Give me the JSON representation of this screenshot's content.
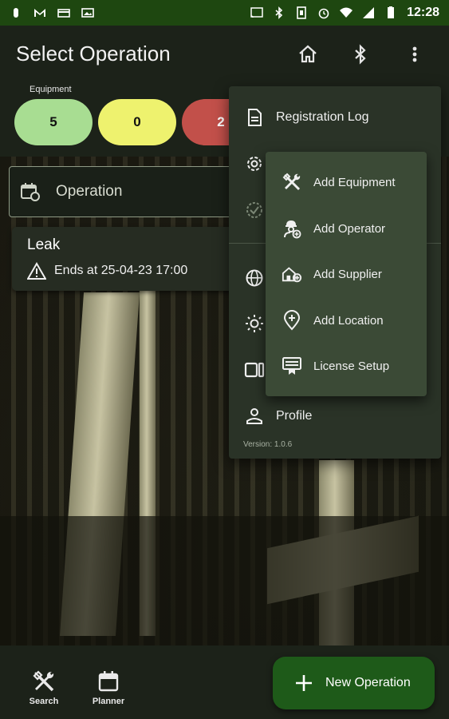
{
  "status_bar": {
    "time": "12:28"
  },
  "app_bar": {
    "title": "Select Operation"
  },
  "counters": {
    "label": "Equipment",
    "green": "5",
    "yellow": "0",
    "red": "2"
  },
  "operation_field": {
    "label": "Operation"
  },
  "leak_card": {
    "title": "Leak",
    "subtitle": "Ends at 25-04-23 17:00"
  },
  "menu": {
    "items": [
      {
        "label": "Registration Log",
        "icon": "document-icon"
      },
      {
        "label": "",
        "icon": "gear-icon"
      },
      {
        "label": "",
        "icon": "check-circle-icon"
      },
      {
        "label": "",
        "icon": "globe-icon"
      },
      {
        "label": "",
        "icon": "sun-icon"
      },
      {
        "label": "",
        "icon": "camera-icon"
      },
      {
        "label": "Profile",
        "icon": "person-icon"
      }
    ],
    "version": "Version: 1.0.6"
  },
  "submenu": {
    "items": [
      {
        "label": "Add Equipment",
        "icon": "tools-icon"
      },
      {
        "label": "Add Operator",
        "icon": "operator-add-icon"
      },
      {
        "label": "Add Supplier",
        "icon": "supplier-add-icon"
      },
      {
        "label": "Add Location",
        "icon": "location-add-icon"
      },
      {
        "label": "License Setup",
        "icon": "license-icon"
      }
    ]
  },
  "bottom_bar": {
    "search_label": "Search",
    "planner_label": "Planner",
    "fab_label": "New Operation"
  },
  "colors": {
    "accent": "#1e5a19",
    "status_bar": "#1e4710",
    "green_pill": "#a8dd92",
    "yellow_pill": "#eef26e",
    "red_pill": "#c2504a"
  }
}
